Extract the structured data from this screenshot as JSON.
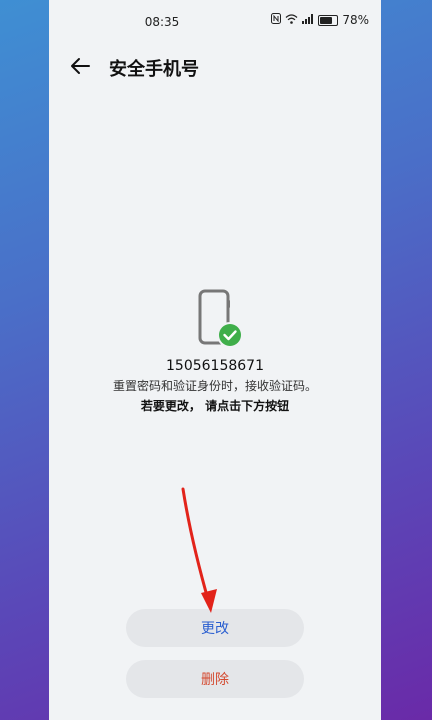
{
  "status_bar": {
    "time": "08:35",
    "battery": "78%"
  },
  "header": {
    "title": "安全手机号"
  },
  "main": {
    "phone_number": "15056158671",
    "description": "重置密码和验证身份时，接收验证码。",
    "hint": "若要更改， 请点击下方按钮"
  },
  "buttons": {
    "change_label": "更改",
    "delete_label": "删除"
  },
  "colors": {
    "accent_blue": "#2a5fd0",
    "danger_red": "#d44a30",
    "check_green": "#3fae4a",
    "annotation_arrow": "#e2231a"
  }
}
